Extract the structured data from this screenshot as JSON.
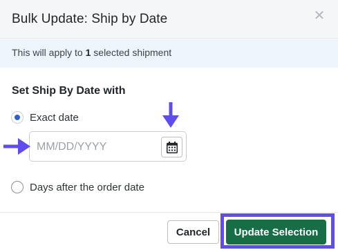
{
  "dialog": {
    "title": "Bulk Update: Ship by Date",
    "close_icon": "close-icon"
  },
  "info": {
    "prefix": "This will apply to ",
    "count": "1",
    "suffix": " selected shipment"
  },
  "section": {
    "title": "Set Ship By Date with"
  },
  "options": [
    {
      "label": "Exact date",
      "checked": true
    },
    {
      "label": "Days after the order date",
      "checked": false
    }
  ],
  "date_field": {
    "placeholder": "MM/DD/YYYY",
    "value": "",
    "calendar_icon": "calendar-icon"
  },
  "annotations": {
    "arrow_color": "#5f4cf0",
    "highlight_color": "#5f4cf0"
  },
  "footer": {
    "cancel_label": "Cancel",
    "update_label": "Update Selection"
  },
  "colors": {
    "primary": "#176d46",
    "radio_selected": "#2e5fd1",
    "info_bg": "#eef5fc"
  }
}
